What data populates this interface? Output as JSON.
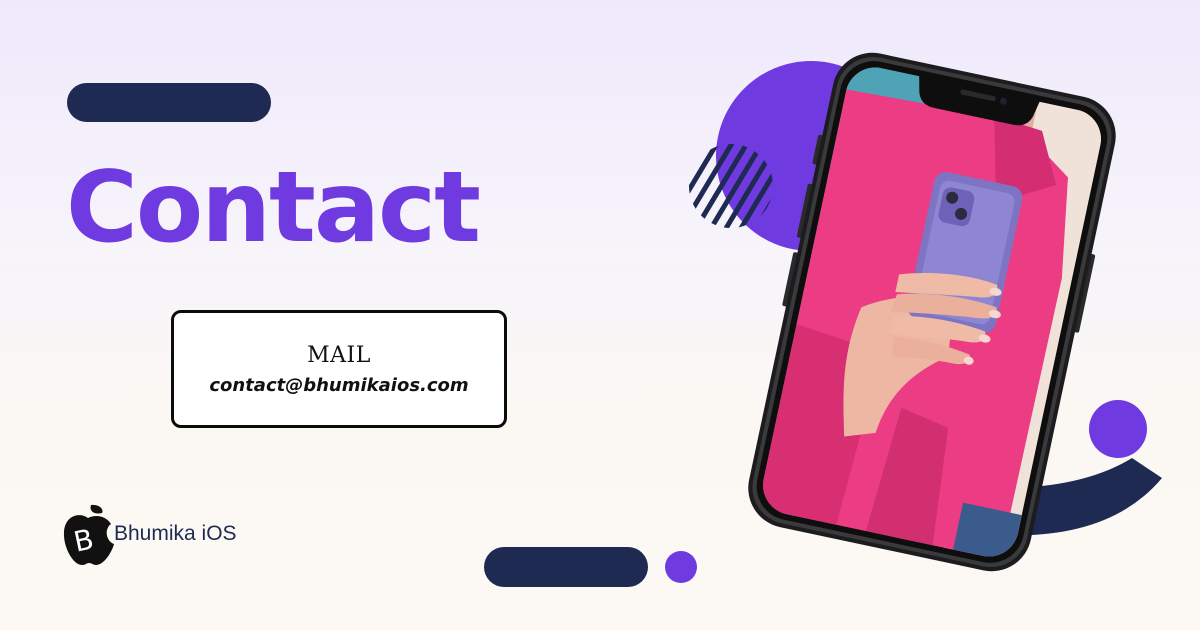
{
  "page": {
    "title": "Contact"
  },
  "contact_card": {
    "label": "MAIL",
    "email": "contact@bhumikaios.com"
  },
  "brand": {
    "logo_letter": "B",
    "name": "Bhumika iOS"
  },
  "colors": {
    "accent_purple": "#6f3ae0",
    "navy": "#1e2a52",
    "pink": "#ec3d84"
  },
  "icons": {
    "logo": "apple-logo-icon",
    "photo": "phone-mockup-photo"
  }
}
